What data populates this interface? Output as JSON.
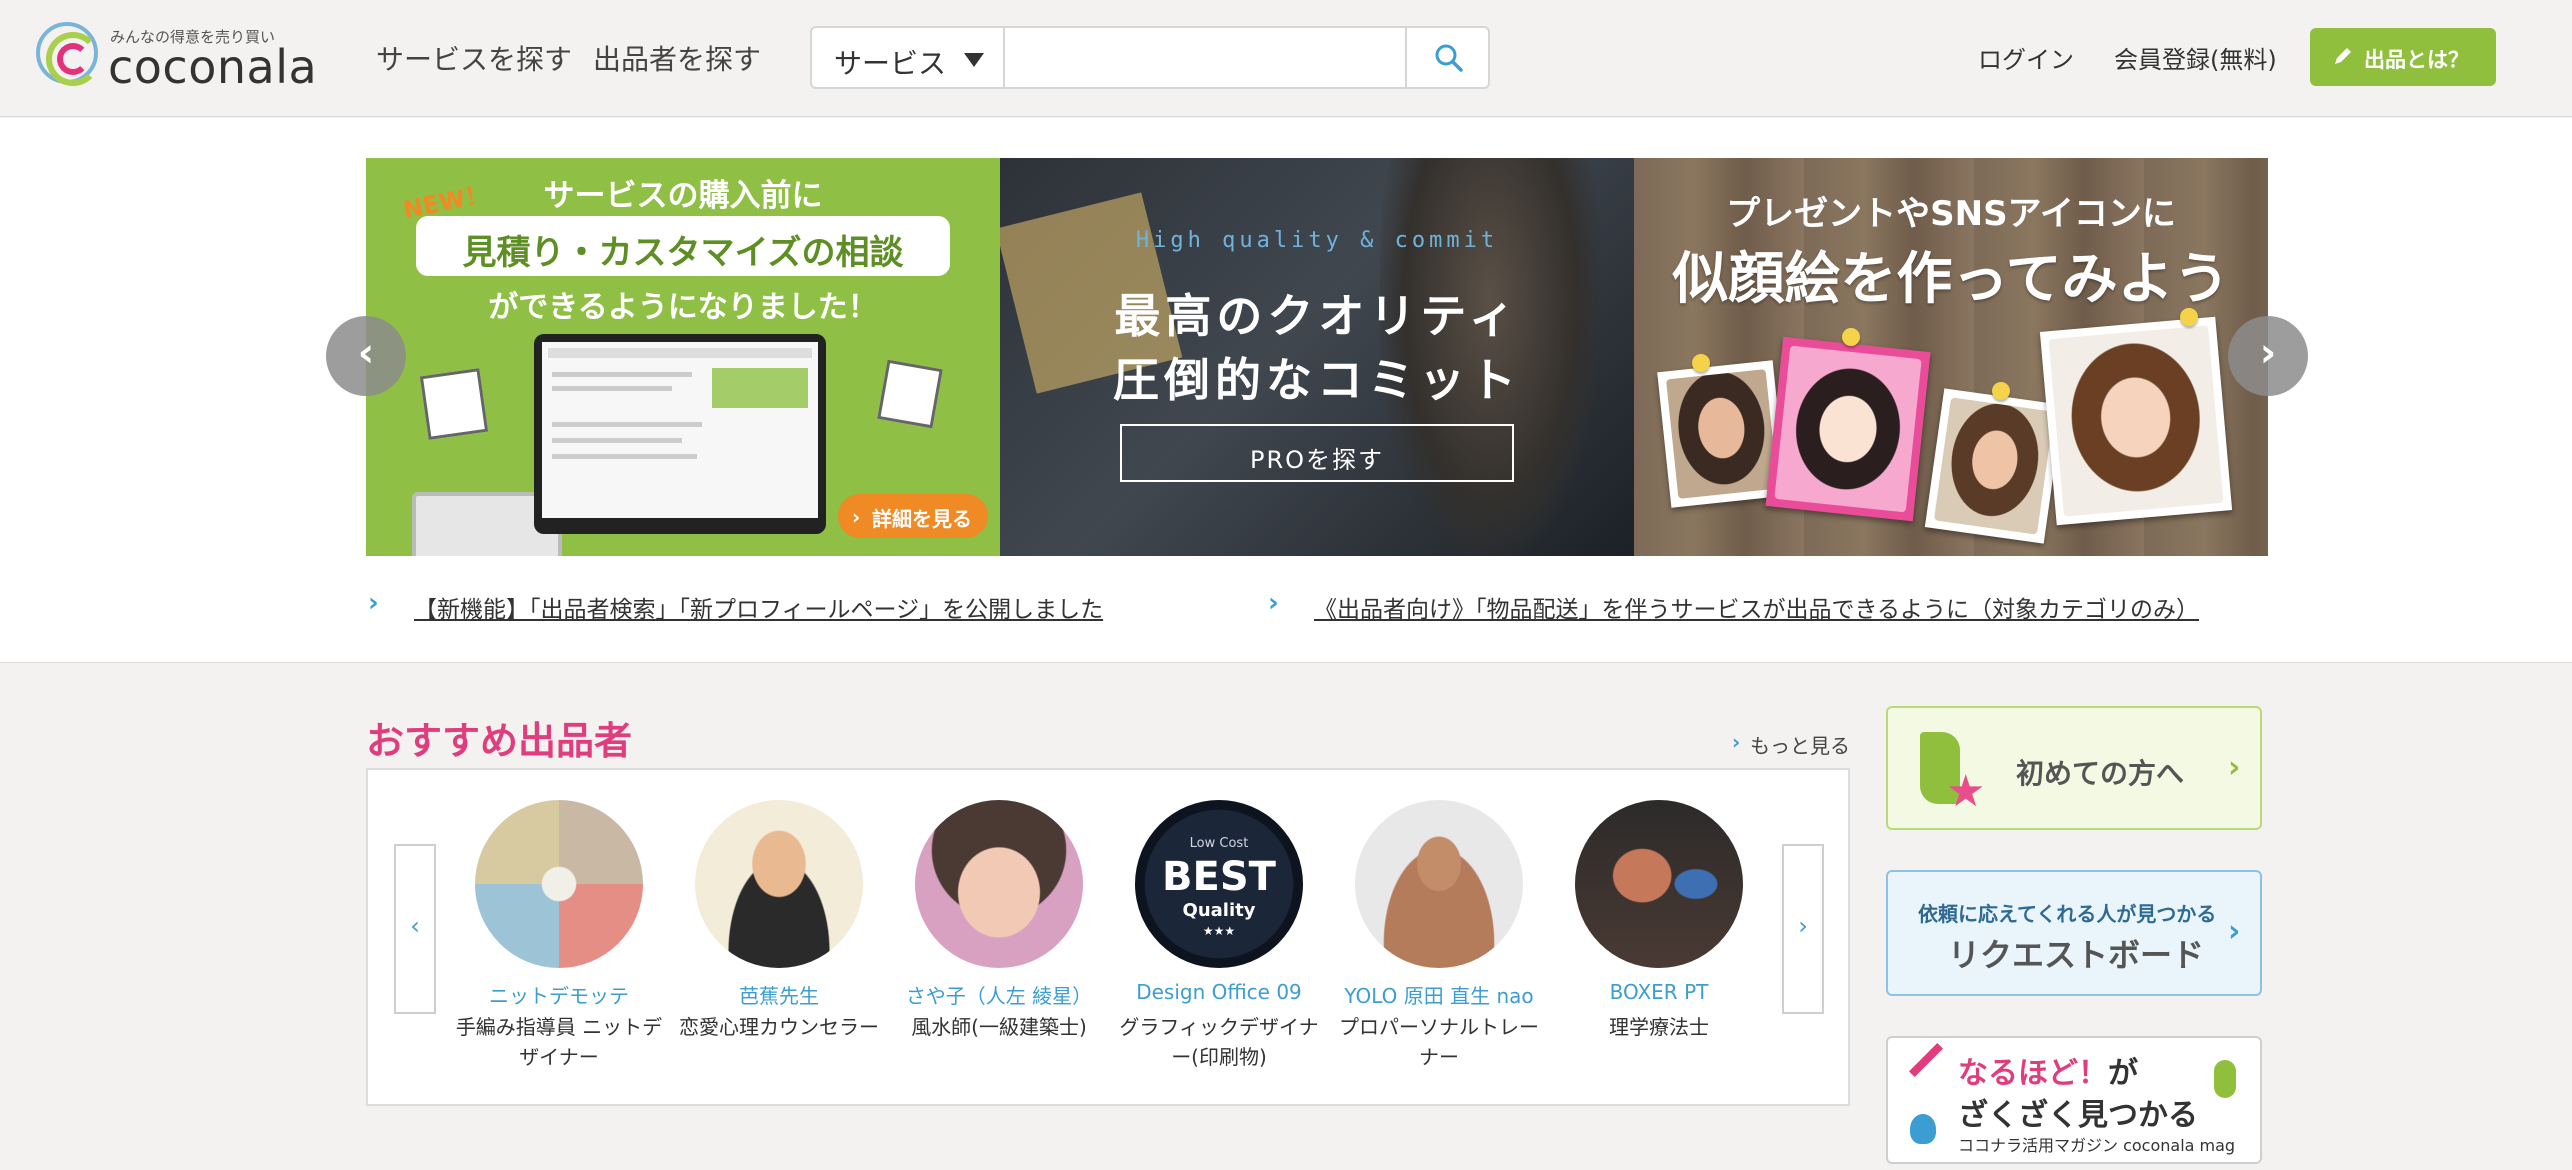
{
  "header": {
    "logo_tagline": "みんなの得意を売り買い",
    "logo_word": "coconala",
    "nav": [
      "サービスを探す",
      "出品者を探す"
    ],
    "search": {
      "category": "サービス",
      "placeholder": ""
    },
    "login": "ログイン",
    "register": "会員登録(無料)",
    "sell_button": "出品とは？"
  },
  "banners": [
    {
      "new_badge": "NEW！",
      "line1": "サービスの購入前に",
      "highlight": "見積り・カスタマイズの相談",
      "line3": "ができるようになりました！",
      "detail_button": "詳細を見る"
    },
    {
      "tagline": "High quality & commit",
      "title_line1": "最高のクオリティ",
      "title_line2": "圧倒的なコミット",
      "button": "PROを探す"
    },
    {
      "line1": "プレゼントやSNSアイコンに",
      "line2": "似顔絵を作ってみよう"
    }
  ],
  "news": [
    "【新機能】「出品者検索」「新プロフィールページ」を公開しました",
    "《出品者向け》「物品配送」を伴うサービスが出品できるように（対象カテゴリのみ）"
  ],
  "recommended": {
    "title": "おすすめ出品者",
    "more": "もっと見る",
    "sellers": [
      {
        "name": "ニットデモッテ",
        "role": "手編み指導員 ニットデザイナー"
      },
      {
        "name": "芭蕉先生",
        "role": "恋愛心理カウンセラー"
      },
      {
        "name": "さや子（人左 綾星）",
        "role": "風水師(一級建築士)"
      },
      {
        "name": "Design Office 09",
        "role": "グラフィックデザイナー(印刷物)",
        "avatar_text": {
          "small": "Low Cost",
          "big": "BEST",
          "mid": "Quality",
          "stars": "★★★"
        }
      },
      {
        "name": "YOLO 原田 直生 nao",
        "role": "プロパーソナルトレーナー"
      },
      {
        "name": "BOXER PT",
        "role": "理学療法士"
      }
    ]
  },
  "sidebar": {
    "beginner": "初めての方へ",
    "request_small": "依頼に応えてくれる人が見つかる",
    "request_big": "リクエストボード",
    "magazine_pink": "なるほど！",
    "magazine_dark": "が",
    "magazine_line2": "ざくざく見つかる",
    "magazine_foot": "ココナラ活用マガジン coconala mag"
  },
  "colors": {
    "brand_green": "#8fbf3d",
    "accent_pink": "#e03d7e",
    "link_blue": "#3b9dd1",
    "cta_orange": "#f08a24"
  }
}
